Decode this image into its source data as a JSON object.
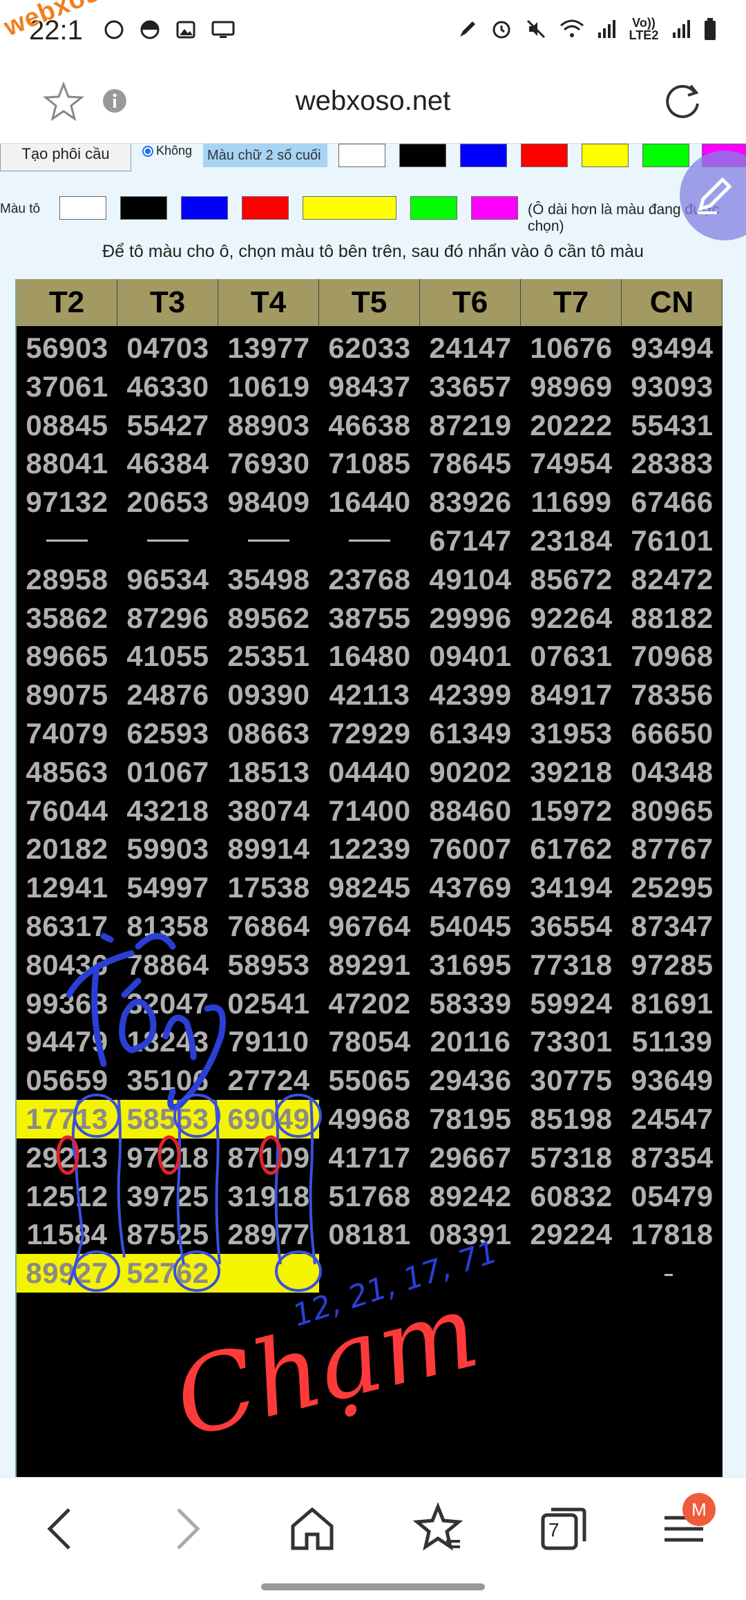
{
  "status_bar": {
    "time": "22:1",
    "watermark": "webxoso.net",
    "network_label": "Vo)) LTE2"
  },
  "browser": {
    "url": "webxoso.net",
    "tabs_count": "7",
    "menu_badge": "M"
  },
  "toolbar": {
    "pattern_button": "Tạo phôi cầu",
    "radio_label": "Không",
    "last2_color_label": "Màu chữ 2 số cuối",
    "fill_color_label": "Màu tô",
    "longer_note": "(Ô dài hơn là màu đang được chọn)",
    "instruction": "Để tô màu cho ô, chọn màu tô bên trên, sau đó nhấn vào ô cần tô màu",
    "text_colors": [
      "#ffffff",
      "#000000",
      "#0000ff",
      "#ff0000",
      "#ffff00",
      "#00ff00",
      "#ff00ff"
    ],
    "fill_colors": [
      "#ffffff",
      "#000000",
      "#0000ff",
      "#ff0000",
      "#ffff00",
      "#00ff00",
      "#ff00ff"
    ]
  },
  "table": {
    "headers": [
      "T2",
      "T3",
      "T4",
      "T5",
      "T6",
      "T7",
      "CN"
    ],
    "rows": [
      [
        "56903",
        "04703",
        "13977",
        "62033",
        "24147",
        "10676",
        "93494"
      ],
      [
        "37061",
        "46330",
        "10619",
        "98437",
        "33657",
        "98969",
        "93093"
      ],
      [
        "08845",
        "55427",
        "88903",
        "46638",
        "87219",
        "20222",
        "55431"
      ],
      [
        "88041",
        "46384",
        "76930",
        "71085",
        "78645",
        "74954",
        "28383"
      ],
      [
        "97132",
        "20653",
        "98409",
        "16440",
        "83926",
        "11699",
        "67466"
      ],
      [
        "",
        "",
        "",
        "",
        "67147",
        "23184",
        "76101"
      ],
      [
        "28958",
        "96534",
        "35498",
        "23768",
        "49104",
        "85672",
        "82472"
      ],
      [
        "35862",
        "87296",
        "89562",
        "38755",
        "29996",
        "92264",
        "88182"
      ],
      [
        "89665",
        "41055",
        "25351",
        "16480",
        "09401",
        "07631",
        "70968"
      ],
      [
        "89075",
        "24876",
        "09390",
        "42113",
        "42399",
        "84917",
        "78356"
      ],
      [
        "74079",
        "62593",
        "08663",
        "72929",
        "61349",
        "31953",
        "66650"
      ],
      [
        "48563",
        "01067",
        "18513",
        "04440",
        "90202",
        "39218",
        "04348"
      ],
      [
        "76044",
        "43218",
        "38074",
        "71400",
        "88460",
        "15972",
        "80965"
      ],
      [
        "20182",
        "59903",
        "89914",
        "12239",
        "76007",
        "61762",
        "87767"
      ],
      [
        "12941",
        "54997",
        "17538",
        "98245",
        "43769",
        "34194",
        "25295"
      ],
      [
        "86317",
        "81358",
        "76864",
        "96764",
        "54045",
        "36554",
        "87347"
      ],
      [
        "80436",
        "78864",
        "58953",
        "89291",
        "31695",
        "77318",
        "97285"
      ],
      [
        "99368",
        "32047",
        "02541",
        "47202",
        "58339",
        "59924",
        "81691"
      ],
      [
        "94479",
        "18243",
        "79110",
        "78054",
        "20116",
        "73301",
        "51139"
      ],
      [
        "05659",
        "35106",
        "27724",
        "55065",
        "29436",
        "30775",
        "93649"
      ],
      [
        "17713",
        "58553",
        "69049",
        "49968",
        "78195",
        "85198",
        "24547"
      ],
      [
        "29213",
        "97218",
        "87109",
        "41717",
        "29667",
        "57318",
        "87354"
      ],
      [
        "12512",
        "39725",
        "31918",
        "51768",
        "89242",
        "60832",
        "05479"
      ],
      [
        "11584",
        "87525",
        "28977",
        "08181",
        "08391",
        "29224",
        "17818"
      ],
      [
        "89927",
        "52762",
        "",
        "",
        "",
        "",
        ""
      ]
    ],
    "dash_cells": [
      [
        5,
        0
      ],
      [
        5,
        1
      ],
      [
        5,
        2
      ],
      [
        5,
        3
      ]
    ],
    "highlight_cells": [
      [
        20,
        0
      ],
      [
        20,
        1
      ],
      [
        20,
        2
      ],
      [
        24,
        0
      ],
      [
        24,
        1
      ],
      [
        24,
        2
      ]
    ],
    "highlight_color": "#f4f400"
  },
  "annotations": {
    "numbers": "12, 21, 17, 71",
    "word_cham": "Chạm",
    "word_tong": "Tổng"
  }
}
